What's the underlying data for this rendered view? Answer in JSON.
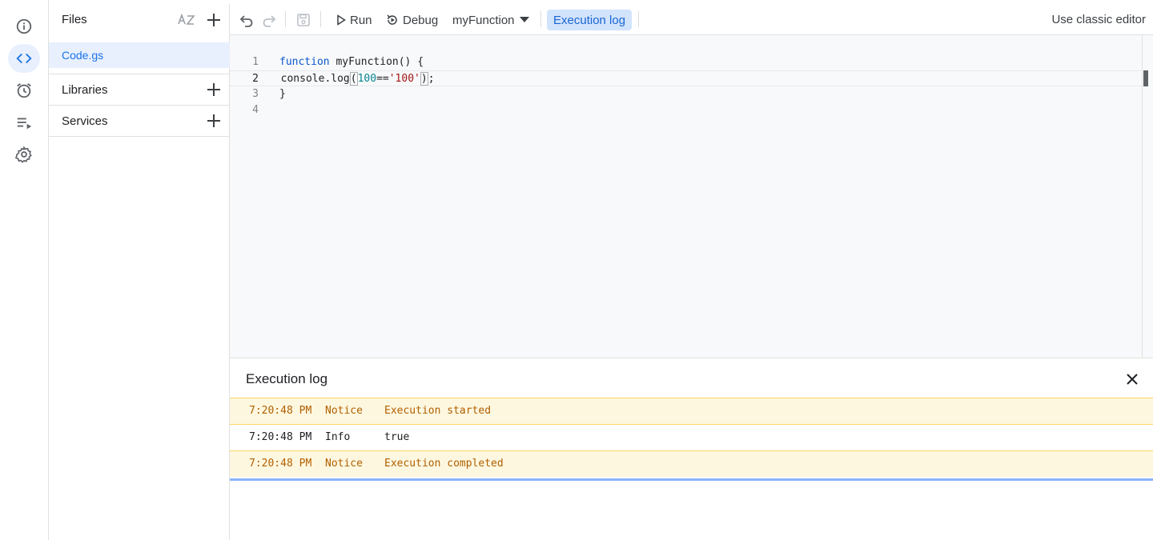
{
  "files_panel": {
    "title": "Files",
    "files": [
      {
        "name": "Code.gs"
      }
    ],
    "sections": [
      {
        "label": "Libraries"
      },
      {
        "label": "Services"
      }
    ]
  },
  "toolbar": {
    "run_label": "Run",
    "debug_label": "Debug",
    "function_select": "myFunction",
    "exec_log_label": "Execution log",
    "classic_label": "Use classic editor"
  },
  "editor": {
    "current_line": 2,
    "lines": [
      {
        "num": "1"
      },
      {
        "num": "2"
      },
      {
        "num": "3",
        "text": "}"
      },
      {
        "num": "4",
        "text": ""
      }
    ],
    "tokens": {
      "l1_kw": "function",
      "l1_rest": " myFunction() {",
      "l2_a": "  console.log",
      "l2_open": "(",
      "l2_num": "100",
      "l2_op": "==",
      "l2_str": "'100'",
      "l2_close": ")",
      "l2_end": ";"
    }
  },
  "execution_log": {
    "title": "Execution log",
    "rows": [
      {
        "time": "7:20:48 PM",
        "level": "Notice",
        "message": "Execution started"
      },
      {
        "time": "7:20:48 PM",
        "level": "Info",
        "message": "true"
      },
      {
        "time": "7:20:48 PM",
        "level": "Notice",
        "message": "Execution completed"
      }
    ]
  },
  "colors": {
    "accent": "#1a73e8",
    "active_bg": "#e8f0fe",
    "notice_bg": "#fef7e0",
    "notice_text": "#b06000"
  },
  "icons": {
    "rail": [
      "info-icon",
      "code-icon",
      "alarm-clock-icon",
      "executions-icon",
      "settings-gear-icon"
    ],
    "toolbar": [
      "undo-icon",
      "redo-icon",
      "save-icon",
      "play-icon",
      "debug-icon",
      "dropdown-arrow-icon"
    ]
  }
}
